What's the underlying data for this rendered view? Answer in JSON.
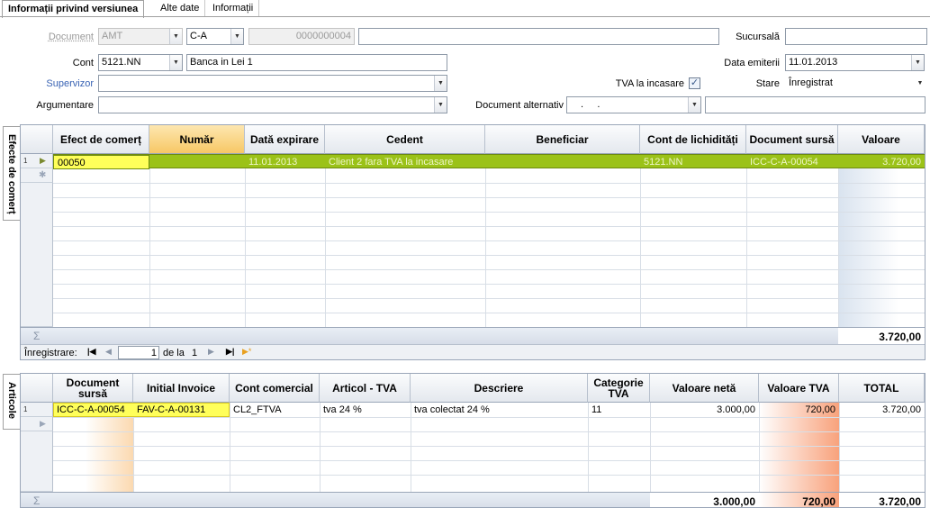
{
  "tabs": [
    "Informații privind versiunea",
    "Alte date",
    "Informații"
  ],
  "form": {
    "document_label": "Document",
    "document_type": "AMT",
    "document_series": "C-A",
    "document_number": "0000000004",
    "sucursala_label": "Sucursală",
    "cont_label": "Cont",
    "cont_value": "5121.NN",
    "cont_name": "Banca in Lei 1",
    "data_emiterii_label": "Data emiterii",
    "data_emiterii": "11.01.2013",
    "supervizor_label": "Supervizor",
    "tva_incasare_label": "TVA la incasare",
    "stare_label": "Stare",
    "stare_value": "Înregistrat",
    "argumentare_label": "Argumentare",
    "doc_alt_label": "Document alternativ",
    "doc_alt_value": ".     ."
  },
  "grid1": {
    "sidetab": "Efecte de comerț",
    "columns": [
      "Efect de comerț",
      "Număr",
      "Dată expirare",
      "Cedent",
      "Beneficiar",
      "Cont de lichidități",
      "Document sursă",
      "Valoare"
    ],
    "row_number": "1",
    "row": [
      "00050",
      "",
      "11.01.2013",
      "Client 2 fara TVA la incasare",
      "",
      "5121.NN",
      "ICC-C-A-00054",
      "3.720,00"
    ],
    "sum_symbol": "Σ",
    "total": "3.720,00",
    "nav_label": "Înregistrare:",
    "nav_current": "1",
    "nav_of": "de la",
    "nav_total": "1"
  },
  "grid2": {
    "sidetab": "Articole",
    "columns": [
      "Document sursă",
      "Initial Invoice",
      "Cont comercial",
      "Articol - TVA",
      "Descriere",
      "Categorie TVA",
      "Valoare netă",
      "Valoare TVA",
      "TOTAL"
    ],
    "row_number": "1",
    "row": [
      "ICC-C-A-00054",
      "FAV-C-A-00131",
      "CL2_FTVA",
      "tva 24 %",
      "tva colectat 24 %",
      "11",
      "3.000,00",
      "720,00",
      "3.720,00"
    ],
    "sum_symbol": "Σ",
    "totals": [
      "3.000,00",
      "720,00",
      "3.720,00"
    ]
  },
  "colors": {
    "selected_row": "#9bc218",
    "highlight": "#ffff5a",
    "header_selected": "#f7c765",
    "accent_link": "#3a64b4"
  }
}
